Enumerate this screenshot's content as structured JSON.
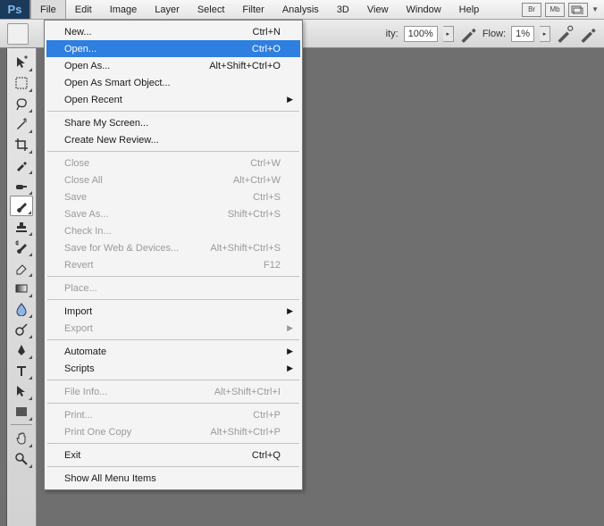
{
  "app_logo": "Ps",
  "menubar": [
    "File",
    "Edit",
    "Image",
    "Layer",
    "Select",
    "Filter",
    "Analysis",
    "3D",
    "View",
    "Window",
    "Help"
  ],
  "menubar_right": [
    "Br",
    "Mb"
  ],
  "optbar": {
    "opacity_label": "ity:",
    "opacity_value": "100%",
    "flow_label": "Flow:",
    "flow_value": "1%"
  },
  "dropdown": {
    "groups": [
      [
        {
          "label": "New...",
          "shortcut": "Ctrl+N",
          "enabled": true,
          "sub": false
        },
        {
          "label": "Open...",
          "shortcut": "Ctrl+O",
          "enabled": true,
          "sub": false,
          "hl": true
        },
        {
          "label": "Open As...",
          "shortcut": "Alt+Shift+Ctrl+O",
          "enabled": true,
          "sub": false
        },
        {
          "label": "Open As Smart Object...",
          "shortcut": "",
          "enabled": true,
          "sub": false
        },
        {
          "label": "Open Recent",
          "shortcut": "",
          "enabled": true,
          "sub": true
        }
      ],
      [
        {
          "label": "Share My Screen...",
          "shortcut": "",
          "enabled": true,
          "sub": false
        },
        {
          "label": "Create New Review...",
          "shortcut": "",
          "enabled": true,
          "sub": false
        }
      ],
      [
        {
          "label": "Close",
          "shortcut": "Ctrl+W",
          "enabled": false,
          "sub": false
        },
        {
          "label": "Close All",
          "shortcut": "Alt+Ctrl+W",
          "enabled": false,
          "sub": false
        },
        {
          "label": "Save",
          "shortcut": "Ctrl+S",
          "enabled": false,
          "sub": false
        },
        {
          "label": "Save As...",
          "shortcut": "Shift+Ctrl+S",
          "enabled": false,
          "sub": false
        },
        {
          "label": "Check In...",
          "shortcut": "",
          "enabled": false,
          "sub": false
        },
        {
          "label": "Save for Web & Devices...",
          "shortcut": "Alt+Shift+Ctrl+S",
          "enabled": false,
          "sub": false
        },
        {
          "label": "Revert",
          "shortcut": "F12",
          "enabled": false,
          "sub": false
        }
      ],
      [
        {
          "label": "Place...",
          "shortcut": "",
          "enabled": false,
          "sub": false
        }
      ],
      [
        {
          "label": "Import",
          "shortcut": "",
          "enabled": true,
          "sub": true
        },
        {
          "label": "Export",
          "shortcut": "",
          "enabled": false,
          "sub": true
        }
      ],
      [
        {
          "label": "Automate",
          "shortcut": "",
          "enabled": true,
          "sub": true
        },
        {
          "label": "Scripts",
          "shortcut": "",
          "enabled": true,
          "sub": true
        }
      ],
      [
        {
          "label": "File Info...",
          "shortcut": "Alt+Shift+Ctrl+I",
          "enabled": false,
          "sub": false
        }
      ],
      [
        {
          "label": "Print...",
          "shortcut": "Ctrl+P",
          "enabled": false,
          "sub": false
        },
        {
          "label": "Print One Copy",
          "shortcut": "Alt+Shift+Ctrl+P",
          "enabled": false,
          "sub": false
        }
      ],
      [
        {
          "label": "Exit",
          "shortcut": "Ctrl+Q",
          "enabled": true,
          "sub": false
        }
      ],
      [
        {
          "label": "Show All Menu Items",
          "shortcut": "",
          "enabled": true,
          "sub": false
        }
      ]
    ]
  },
  "tools": [
    "move",
    "marquee",
    "lasso",
    "wand",
    "crop",
    "eyedropper",
    "spot-heal",
    "brush",
    "stamp",
    "history-brush",
    "eraser",
    "gradient",
    "blur",
    "dodge",
    "pen",
    "type",
    "path-select",
    "rectangle",
    "hand",
    "zoom"
  ]
}
